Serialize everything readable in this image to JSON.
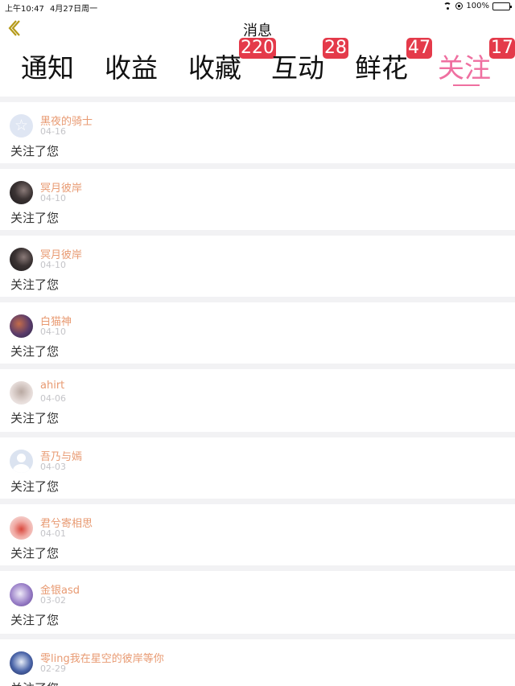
{
  "status_bar": {
    "time": "上午10:47",
    "date": "4月27日周一",
    "battery": "100%",
    "battery_level": 1.0
  },
  "nav": {
    "title": "消息",
    "back_icon": "chevron-left-icon"
  },
  "tabs": [
    {
      "label": "通知",
      "badge": "",
      "active": false
    },
    {
      "label": "收益",
      "badge": "",
      "active": false
    },
    {
      "label": "收藏",
      "badge": "220",
      "active": false
    },
    {
      "label": "互动",
      "badge": "28",
      "active": false
    },
    {
      "label": "鲜花",
      "badge": "47",
      "active": false
    },
    {
      "label": "关注",
      "badge": "17",
      "active": true
    }
  ],
  "colors": {
    "accent": "#ef6fa0",
    "badge": "#e43a4a",
    "name": "#e89a72",
    "back_icon": "#b59a1a"
  },
  "items": [
    {
      "name": "黑夜的骑士",
      "date": "04-16",
      "message": "关注了您",
      "avatar": "default-star-avatar"
    },
    {
      "name": "冥月彼岸",
      "date": "04-10",
      "message": "关注了您",
      "avatar": "photo-avatar"
    },
    {
      "name": "冥月彼岸",
      "date": "04-10",
      "message": "关注了您",
      "avatar": "photo-avatar"
    },
    {
      "name": "白猫神",
      "date": "04-10",
      "message": "关注了您",
      "avatar": "photo-avatar"
    },
    {
      "name": "ahirt",
      "date": "04-06",
      "message": "关注了您",
      "avatar": "photo-avatar"
    },
    {
      "name": "吾乃与嫣",
      "date": "04-03",
      "message": "关注了您",
      "avatar": "default-person-avatar"
    },
    {
      "name": "君兮寄相思",
      "date": "04-01",
      "message": "关注了您",
      "avatar": "photo-avatar"
    },
    {
      "name": "金银asd",
      "date": "03-02",
      "message": "关注了您",
      "avatar": "photo-avatar"
    },
    {
      "name": "零ling我在星空的彼岸等你",
      "date": "02-29",
      "message": "关注了您",
      "avatar": "photo-avatar"
    }
  ]
}
